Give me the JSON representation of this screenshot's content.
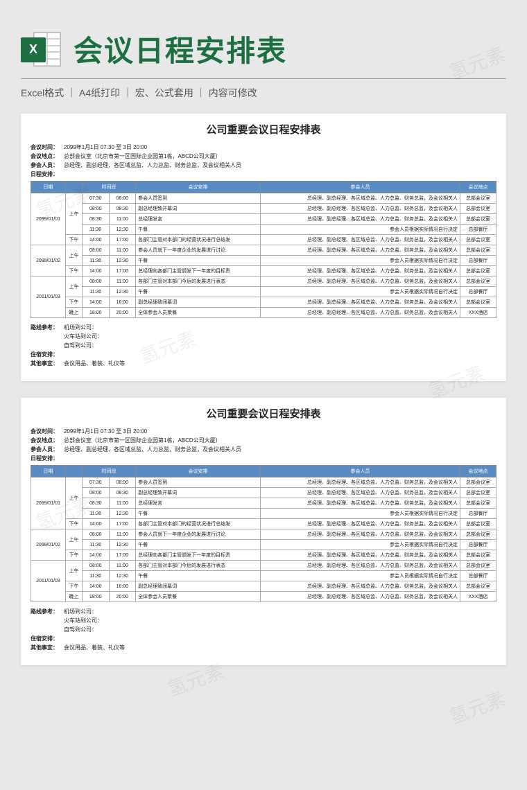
{
  "header": {
    "icon_letter": "X",
    "title": "会议日程安排表",
    "subinfo": "Excel格式 ｜ A4纸打印 ｜ 宏、公式套用 ｜ 内容可修改"
  },
  "watermark_text": "氢元素",
  "doc": {
    "title": "公司重要会议日程安排表",
    "meta": [
      {
        "label": "会议时间：",
        "value": "2099年1月1日 07:30 至 3日 20:00"
      },
      {
        "label": "会议地点：",
        "value": "总部会议室（北京市第一区国际企业园第1栋，ABCD公司大厦）"
      },
      {
        "label": "参会人员：",
        "value": "总经理、副总经理、各区域总监、人力总监、财务总监，及会议相关人员"
      },
      {
        "label": "日程安排：",
        "value": ""
      }
    ],
    "columns": [
      "日期",
      "",
      "时间段",
      "",
      "会议安排",
      "参会人员",
      "会议地点"
    ],
    "rows": [
      {
        "date": "2099/01/01",
        "period": "上午",
        "t1": "07:30",
        "t2": "08:00",
        "task": "参会人员签到",
        "people": "总经理、副总经理、各区域总监、人力总监、财务总监，及会议相关人",
        "place": "总部会议室",
        "date_rs": 5,
        "period_rs": 4
      },
      {
        "t1": "08:00",
        "t2": "08:30",
        "task": "副总经理致开幕词",
        "people": "总经理、副总经理、各区域总监、人力总监、财务总监，及会议相关人",
        "place": "总部会议室"
      },
      {
        "t1": "08:30",
        "t2": "11:00",
        "task": "总经理发言",
        "people": "总经理、副总经理、各区域总监、人力总监、财务总监，及会议相关人",
        "place": "总部会议室"
      },
      {
        "t1": "11:30",
        "t2": "12:30",
        "task": "午餐",
        "people": "参会人员根据实际情况自行决定",
        "place": "总部餐厅"
      },
      {
        "period": "下午",
        "t1": "14:00",
        "t2": "17:00",
        "task": "各部门主管对本部门的经营状况进行总结发",
        "people": "总经理、副总经理、各区域总监、人力总监、财务总监，及会议相关人",
        "place": "总部会议室",
        "period_rs": 1
      },
      {
        "date": "2099/01/02",
        "period": "上午",
        "t1": "08:00",
        "t2": "11:00",
        "task": "参会人员就下一年度企业的发展进行讨论",
        "people": "总经理、副总经理、各区域总监、人力总监、财务总监，及会议相关人",
        "place": "总部会议室",
        "date_rs": 3,
        "period_rs": 2
      },
      {
        "t1": "11:30",
        "t2": "12:30",
        "task": "午餐",
        "people": "参会人员根据实际情况自行决定",
        "place": "总部餐厅"
      },
      {
        "period": "下午",
        "t1": "14:00",
        "t2": "17:00",
        "task": "总经理向各部门主管颁发下一年度的目标责",
        "people": "总经理、副总经理、各区域总监、人力总监、财务总监，及会议相关人",
        "place": "总部会议室",
        "period_rs": 1
      },
      {
        "date": "2011/01/03",
        "period": "上午",
        "t1": "08:00",
        "t2": "11:00",
        "task": "各部门主管对本部门今后的发展进行表态",
        "people": "总经理、副总经理、各区域总监、人力总监、财务总监，及会议相关人",
        "place": "总部会议室",
        "date_rs": 4,
        "period_rs": 2
      },
      {
        "t1": "11:30",
        "t2": "12:30",
        "task": "午餐",
        "people": "参会人员根据实际情况自行决定",
        "place": "总部餐厅"
      },
      {
        "period": "下午",
        "t1": "14:00",
        "t2": "16:00",
        "task": "副总经理致闭幕词",
        "people": "总经理、副总经理、各区域总监、人力总监、财务总监，及会议相关人",
        "place": "总部会议室",
        "period_rs": 1
      },
      {
        "period": "晚上",
        "t1": "18:00",
        "t2": "20:00",
        "task": "全体参会人员聚餐",
        "people": "总经理、副总经理、各区域总监、人力总监、财务总监，及会议相关人",
        "place": "XXX酒店",
        "period_rs": 1
      }
    ],
    "footer": [
      {
        "label": "路线参考：",
        "lines": [
          "机场到公司：",
          "火车站到公司：",
          "自驾到公司："
        ]
      },
      {
        "label": "住宿安排：",
        "lines": [
          ""
        ]
      },
      {
        "label": "其他事宜：",
        "lines": [
          "会议用品、着装、礼仪等"
        ]
      }
    ]
  }
}
